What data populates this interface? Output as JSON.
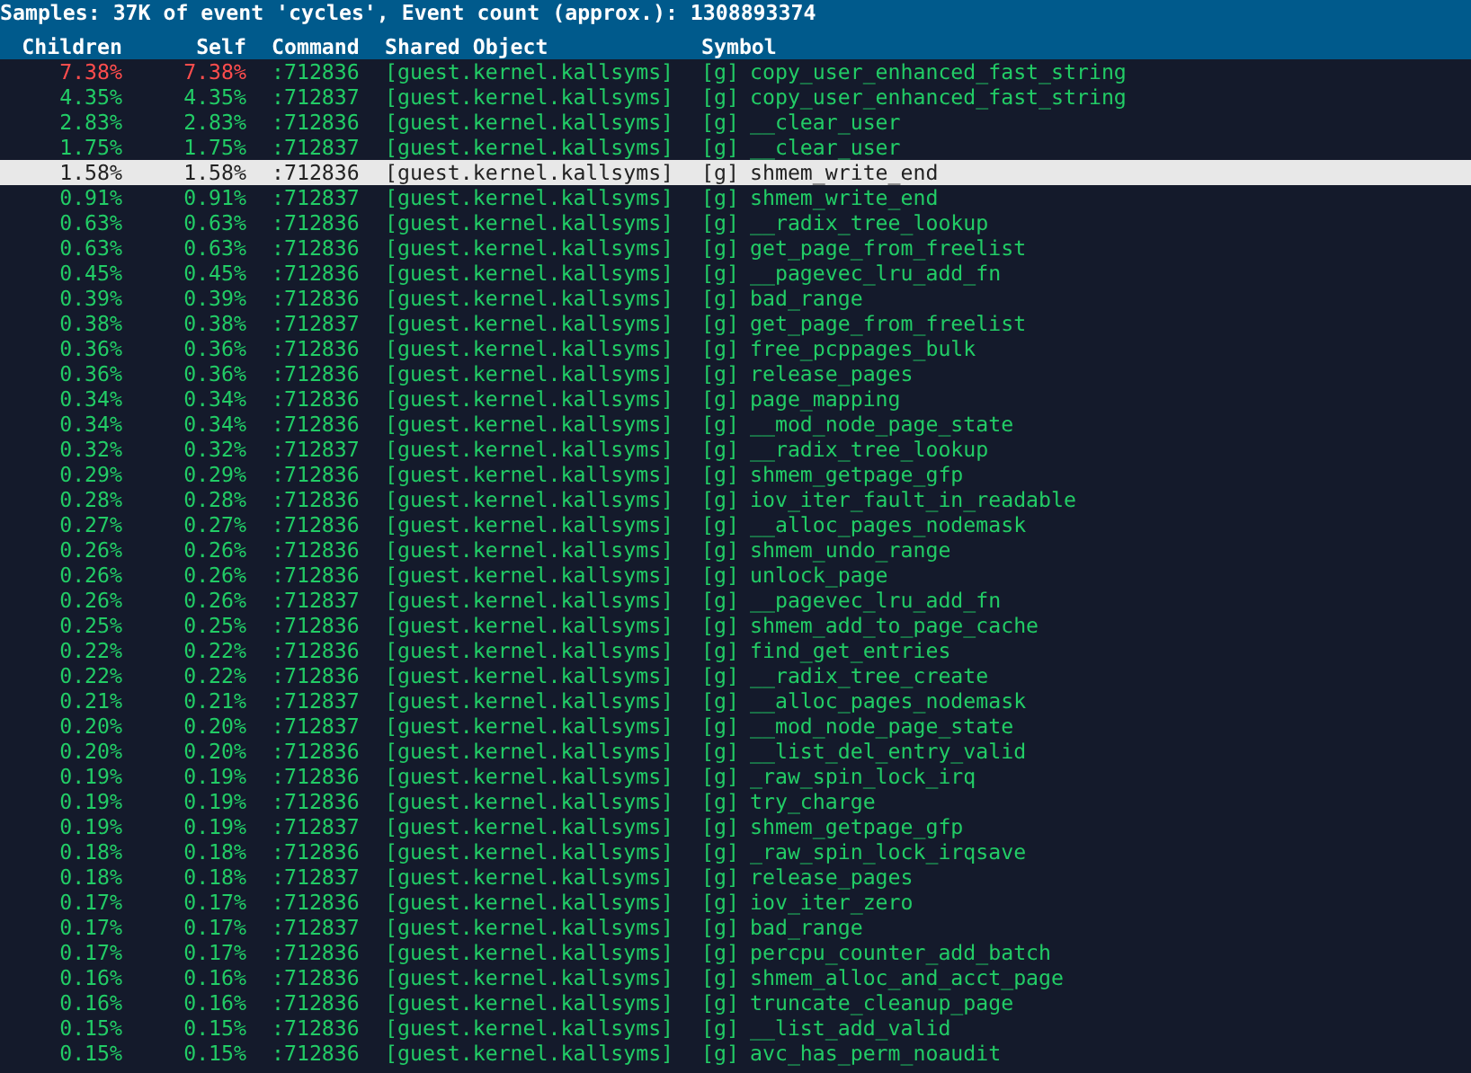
{
  "title": "Samples: 37K of event 'cycles', Event count (approx.): 1308893374",
  "columns": [
    "Children",
    "Self",
    "Command",
    "Shared Object",
    "Symbol"
  ],
  "rows": [
    {
      "children": "7.38%",
      "self": "7.38%",
      "command": ":712836",
      "shared_object": "[guest.kernel.kallsyms]",
      "scope": "[g]",
      "symbol": "copy_user_enhanced_fast_string",
      "selected": false,
      "hot": true
    },
    {
      "children": "4.35%",
      "self": "4.35%",
      "command": ":712837",
      "shared_object": "[guest.kernel.kallsyms]",
      "scope": "[g]",
      "symbol": "copy_user_enhanced_fast_string",
      "selected": false,
      "hot": false
    },
    {
      "children": "2.83%",
      "self": "2.83%",
      "command": ":712836",
      "shared_object": "[guest.kernel.kallsyms]",
      "scope": "[g]",
      "symbol": "__clear_user",
      "selected": false,
      "hot": false
    },
    {
      "children": "1.75%",
      "self": "1.75%",
      "command": ":712837",
      "shared_object": "[guest.kernel.kallsyms]",
      "scope": "[g]",
      "symbol": "__clear_user",
      "selected": false,
      "hot": false
    },
    {
      "children": "1.58%",
      "self": "1.58%",
      "command": ":712836",
      "shared_object": "[guest.kernel.kallsyms]",
      "scope": "[g]",
      "symbol": "shmem_write_end",
      "selected": true,
      "hot": false
    },
    {
      "children": "0.91%",
      "self": "0.91%",
      "command": ":712837",
      "shared_object": "[guest.kernel.kallsyms]",
      "scope": "[g]",
      "symbol": "shmem_write_end",
      "selected": false,
      "hot": false
    },
    {
      "children": "0.63%",
      "self": "0.63%",
      "command": ":712836",
      "shared_object": "[guest.kernel.kallsyms]",
      "scope": "[g]",
      "symbol": "__radix_tree_lookup",
      "selected": false,
      "hot": false
    },
    {
      "children": "0.63%",
      "self": "0.63%",
      "command": ":712836",
      "shared_object": "[guest.kernel.kallsyms]",
      "scope": "[g]",
      "symbol": "get_page_from_freelist",
      "selected": false,
      "hot": false
    },
    {
      "children": "0.45%",
      "self": "0.45%",
      "command": ":712836",
      "shared_object": "[guest.kernel.kallsyms]",
      "scope": "[g]",
      "symbol": "__pagevec_lru_add_fn",
      "selected": false,
      "hot": false
    },
    {
      "children": "0.39%",
      "self": "0.39%",
      "command": ":712836",
      "shared_object": "[guest.kernel.kallsyms]",
      "scope": "[g]",
      "symbol": "bad_range",
      "selected": false,
      "hot": false
    },
    {
      "children": "0.38%",
      "self": "0.38%",
      "command": ":712837",
      "shared_object": "[guest.kernel.kallsyms]",
      "scope": "[g]",
      "symbol": "get_page_from_freelist",
      "selected": false,
      "hot": false
    },
    {
      "children": "0.36%",
      "self": "0.36%",
      "command": ":712836",
      "shared_object": "[guest.kernel.kallsyms]",
      "scope": "[g]",
      "symbol": "free_pcppages_bulk",
      "selected": false,
      "hot": false
    },
    {
      "children": "0.36%",
      "self": "0.36%",
      "command": ":712836",
      "shared_object": "[guest.kernel.kallsyms]",
      "scope": "[g]",
      "symbol": "release_pages",
      "selected": false,
      "hot": false
    },
    {
      "children": "0.34%",
      "self": "0.34%",
      "command": ":712836",
      "shared_object": "[guest.kernel.kallsyms]",
      "scope": "[g]",
      "symbol": "page_mapping",
      "selected": false,
      "hot": false
    },
    {
      "children": "0.34%",
      "self": "0.34%",
      "command": ":712836",
      "shared_object": "[guest.kernel.kallsyms]",
      "scope": "[g]",
      "symbol": "__mod_node_page_state",
      "selected": false,
      "hot": false
    },
    {
      "children": "0.32%",
      "self": "0.32%",
      "command": ":712837",
      "shared_object": "[guest.kernel.kallsyms]",
      "scope": "[g]",
      "symbol": "__radix_tree_lookup",
      "selected": false,
      "hot": false
    },
    {
      "children": "0.29%",
      "self": "0.29%",
      "command": ":712836",
      "shared_object": "[guest.kernel.kallsyms]",
      "scope": "[g]",
      "symbol": "shmem_getpage_gfp",
      "selected": false,
      "hot": false
    },
    {
      "children": "0.28%",
      "self": "0.28%",
      "command": ":712836",
      "shared_object": "[guest.kernel.kallsyms]",
      "scope": "[g]",
      "symbol": "iov_iter_fault_in_readable",
      "selected": false,
      "hot": false
    },
    {
      "children": "0.27%",
      "self": "0.27%",
      "command": ":712836",
      "shared_object": "[guest.kernel.kallsyms]",
      "scope": "[g]",
      "symbol": "__alloc_pages_nodemask",
      "selected": false,
      "hot": false
    },
    {
      "children": "0.26%",
      "self": "0.26%",
      "command": ":712836",
      "shared_object": "[guest.kernel.kallsyms]",
      "scope": "[g]",
      "symbol": "shmem_undo_range",
      "selected": false,
      "hot": false
    },
    {
      "children": "0.26%",
      "self": "0.26%",
      "command": ":712836",
      "shared_object": "[guest.kernel.kallsyms]",
      "scope": "[g]",
      "symbol": "unlock_page",
      "selected": false,
      "hot": false
    },
    {
      "children": "0.26%",
      "self": "0.26%",
      "command": ":712837",
      "shared_object": "[guest.kernel.kallsyms]",
      "scope": "[g]",
      "symbol": "__pagevec_lru_add_fn",
      "selected": false,
      "hot": false
    },
    {
      "children": "0.25%",
      "self": "0.25%",
      "command": ":712836",
      "shared_object": "[guest.kernel.kallsyms]",
      "scope": "[g]",
      "symbol": "shmem_add_to_page_cache",
      "selected": false,
      "hot": false
    },
    {
      "children": "0.22%",
      "self": "0.22%",
      "command": ":712836",
      "shared_object": "[guest.kernel.kallsyms]",
      "scope": "[g]",
      "symbol": "find_get_entries",
      "selected": false,
      "hot": false
    },
    {
      "children": "0.22%",
      "self": "0.22%",
      "command": ":712836",
      "shared_object": "[guest.kernel.kallsyms]",
      "scope": "[g]",
      "symbol": "__radix_tree_create",
      "selected": false,
      "hot": false
    },
    {
      "children": "0.21%",
      "self": "0.21%",
      "command": ":712837",
      "shared_object": "[guest.kernel.kallsyms]",
      "scope": "[g]",
      "symbol": "__alloc_pages_nodemask",
      "selected": false,
      "hot": false
    },
    {
      "children": "0.20%",
      "self": "0.20%",
      "command": ":712837",
      "shared_object": "[guest.kernel.kallsyms]",
      "scope": "[g]",
      "symbol": "__mod_node_page_state",
      "selected": false,
      "hot": false
    },
    {
      "children": "0.20%",
      "self": "0.20%",
      "command": ":712836",
      "shared_object": "[guest.kernel.kallsyms]",
      "scope": "[g]",
      "symbol": "__list_del_entry_valid",
      "selected": false,
      "hot": false
    },
    {
      "children": "0.19%",
      "self": "0.19%",
      "command": ":712836",
      "shared_object": "[guest.kernel.kallsyms]",
      "scope": "[g]",
      "symbol": "_raw_spin_lock_irq",
      "selected": false,
      "hot": false
    },
    {
      "children": "0.19%",
      "self": "0.19%",
      "command": ":712836",
      "shared_object": "[guest.kernel.kallsyms]",
      "scope": "[g]",
      "symbol": "try_charge",
      "selected": false,
      "hot": false
    },
    {
      "children": "0.19%",
      "self": "0.19%",
      "command": ":712837",
      "shared_object": "[guest.kernel.kallsyms]",
      "scope": "[g]",
      "symbol": "shmem_getpage_gfp",
      "selected": false,
      "hot": false
    },
    {
      "children": "0.18%",
      "self": "0.18%",
      "command": ":712836",
      "shared_object": "[guest.kernel.kallsyms]",
      "scope": "[g]",
      "symbol": "_raw_spin_lock_irqsave",
      "selected": false,
      "hot": false
    },
    {
      "children": "0.18%",
      "self": "0.18%",
      "command": ":712837",
      "shared_object": "[guest.kernel.kallsyms]",
      "scope": "[g]",
      "symbol": "release_pages",
      "selected": false,
      "hot": false
    },
    {
      "children": "0.17%",
      "self": "0.17%",
      "command": ":712836",
      "shared_object": "[guest.kernel.kallsyms]",
      "scope": "[g]",
      "symbol": "iov_iter_zero",
      "selected": false,
      "hot": false
    },
    {
      "children": "0.17%",
      "self": "0.17%",
      "command": ":712837",
      "shared_object": "[guest.kernel.kallsyms]",
      "scope": "[g]",
      "symbol": "bad_range",
      "selected": false,
      "hot": false
    },
    {
      "children": "0.17%",
      "self": "0.17%",
      "command": ":712836",
      "shared_object": "[guest.kernel.kallsyms]",
      "scope": "[g]",
      "symbol": "percpu_counter_add_batch",
      "selected": false,
      "hot": false
    },
    {
      "children": "0.16%",
      "self": "0.16%",
      "command": ":712836",
      "shared_object": "[guest.kernel.kallsyms]",
      "scope": "[g]",
      "symbol": "shmem_alloc_and_acct_page",
      "selected": false,
      "hot": false
    },
    {
      "children": "0.16%",
      "self": "0.16%",
      "command": ":712836",
      "shared_object": "[guest.kernel.kallsyms]",
      "scope": "[g]",
      "symbol": "truncate_cleanup_page",
      "selected": false,
      "hot": false
    },
    {
      "children": "0.15%",
      "self": "0.15%",
      "command": ":712836",
      "shared_object": "[guest.kernel.kallsyms]",
      "scope": "[g]",
      "symbol": "__list_add_valid",
      "selected": false,
      "hot": false
    },
    {
      "children": "0.15%",
      "self": "0.15%",
      "command": ":712836",
      "shared_object": "[guest.kernel.kallsyms]",
      "scope": "[g]",
      "symbol": "avc_has_perm_noaudit",
      "selected": false,
      "hot": false
    }
  ]
}
